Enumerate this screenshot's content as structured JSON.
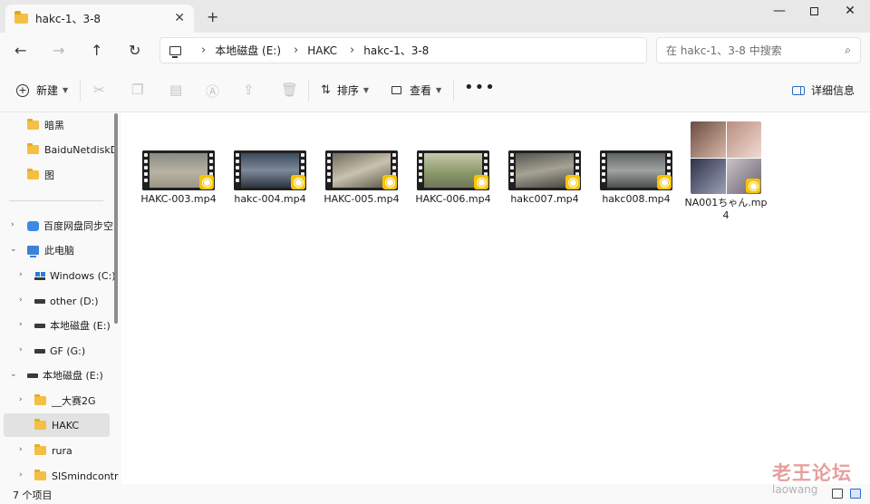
{
  "window": {
    "tab_title": "hakc-1、3-8",
    "tab_close": "✕",
    "new_tab": "+",
    "minimize": "—",
    "close": "✕"
  },
  "nav": {
    "back": "←",
    "forward": "→",
    "up": "↑",
    "refresh": "↻"
  },
  "address": {
    "breadcrumb": [
      "本地磁盘 (E:)",
      "HAKC",
      "hakc-1、3-8"
    ]
  },
  "search": {
    "placeholder": "在 hakc-1、3-8 中搜索"
  },
  "toolbar": {
    "new_label": "新建",
    "sort_label": "排序",
    "view_label": "查看",
    "more_label": "•••",
    "details_label": "详细信息"
  },
  "sidebar": {
    "items": [
      {
        "label": "暗黑",
        "icon": "folder-icon"
      },
      {
        "label": "BaiduNetdiskD",
        "icon": "folder-icon"
      },
      {
        "label": "图",
        "icon": "folder-icon"
      },
      {
        "label": "百度网盘同步空",
        "icon": "cloud-icon"
      },
      {
        "label": "此电脑",
        "icon": "computer-icon"
      },
      {
        "label": "Windows (C:)",
        "icon": "windows-drive-icon"
      },
      {
        "label": "other (D:)",
        "icon": "drive-icon"
      },
      {
        "label": "本地磁盘 (E:)",
        "icon": "drive-icon"
      },
      {
        "label": "GF (G:)",
        "icon": "drive-icon"
      },
      {
        "label": "本地磁盘 (E:)",
        "icon": "drive-icon"
      },
      {
        "label": "__大赛2G",
        "icon": "folder-icon"
      },
      {
        "label": "HAKC",
        "icon": "folder-icon"
      },
      {
        "label": "rura",
        "icon": "folder-icon"
      },
      {
        "label": "SISmindcontr",
        "icon": "folder-icon"
      }
    ]
  },
  "files": [
    {
      "name": "HAKC-003.mp4"
    },
    {
      "name": "hakc-004.mp4"
    },
    {
      "name": "HAKC-005.mp4"
    },
    {
      "name": "HAKC-006.mp4"
    },
    {
      "name": "hakc007.mp4"
    },
    {
      "name": "hakc008.mp4"
    },
    {
      "name": "NA001ちゃん.mp4"
    }
  ],
  "status": {
    "item_count": "7 个项目"
  },
  "watermark": {
    "text": "老王论坛",
    "sub": "laowang"
  },
  "colors": {
    "accent": "#2b6cc4",
    "folder": "#f4c043",
    "selection": "#e2e2e2",
    "player_badge": "#f7c500"
  }
}
